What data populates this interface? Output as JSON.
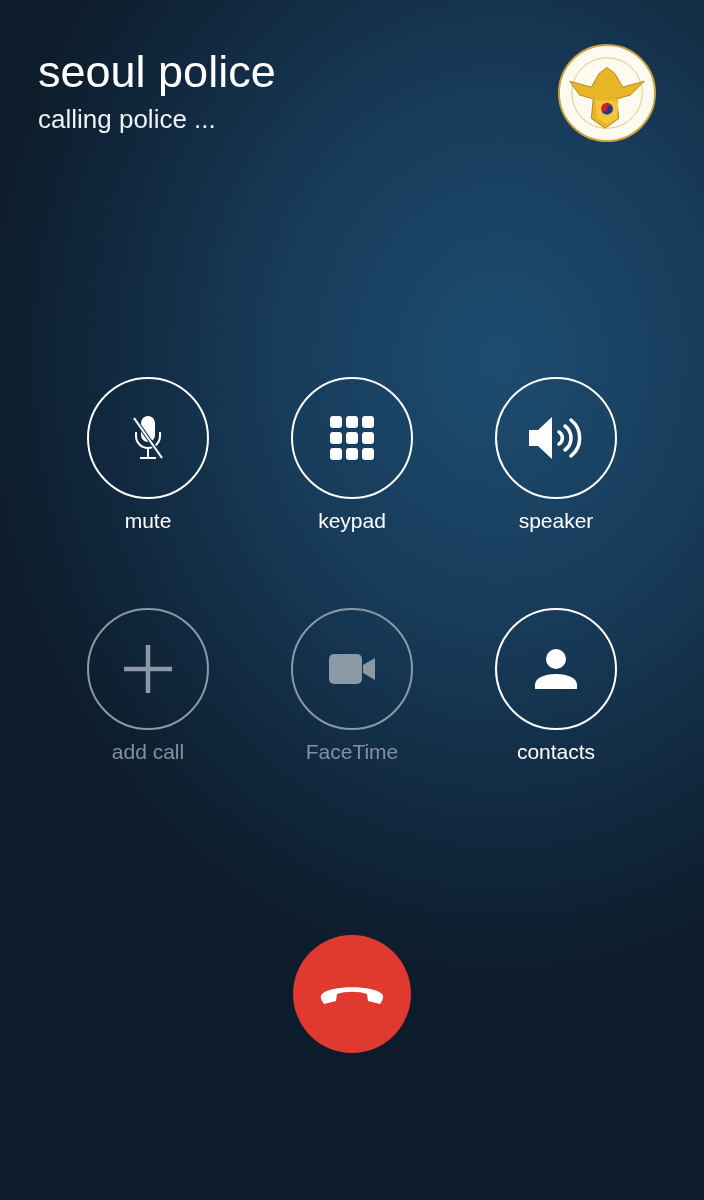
{
  "caller": {
    "name": "seoul police",
    "status": "calling police ..."
  },
  "buttons": [
    {
      "label": "mute",
      "kind": "mute",
      "disabled": false
    },
    {
      "label": "keypad",
      "kind": "keypad",
      "disabled": false
    },
    {
      "label": "speaker",
      "kind": "speaker",
      "disabled": false
    },
    {
      "label": "add call",
      "kind": "add",
      "disabled": true
    },
    {
      "label": "FaceTime",
      "kind": "video",
      "disabled": true
    },
    {
      "label": "contacts",
      "kind": "contacts",
      "disabled": false
    }
  ],
  "end_call": {
    "kind": "hangup"
  }
}
